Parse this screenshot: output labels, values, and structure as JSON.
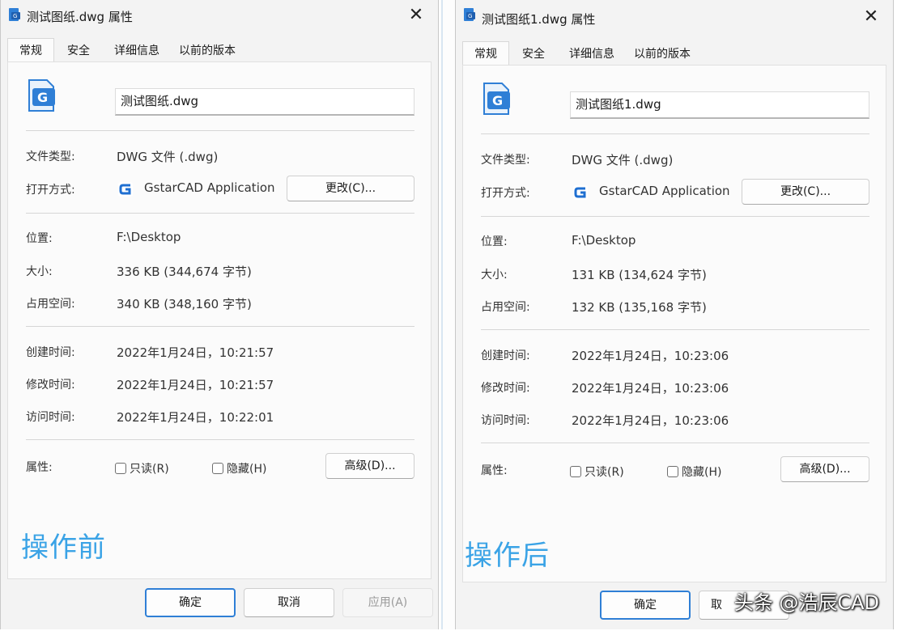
{
  "left": {
    "title": "测试图纸.dwg 属性",
    "tabs": [
      "常规",
      "安全",
      "详细信息",
      "以前的版本"
    ],
    "filename": "测试图纸.dwg",
    "labels": {
      "type": "文件类型:",
      "open_with": "打开方式:",
      "location": "位置:",
      "size": "大小:",
      "size_on_disk": "占用空间:",
      "created": "创建时间:",
      "modified": "修改时间:",
      "accessed": "访问时间:",
      "attributes": "属性:"
    },
    "values": {
      "type": "DWG 文件 (.dwg)",
      "open_with": "GstarCAD Application",
      "location": "F:\\Desktop",
      "size": "336 KB (344,674 字节)",
      "size_on_disk": "340 KB (348,160 字节)",
      "created": "2022年1月24日，10:21:57",
      "modified": "2022年1月24日，10:21:57",
      "accessed": "2022年1月24日，10:22:01"
    },
    "change_button": "更改(C)...",
    "readonly_label": "只读(R)",
    "hidden_label": "隐藏(H)",
    "advanced_button": "高级(D)...",
    "watermark": "操作前",
    "ok_button": "确定",
    "cancel_button": "取消",
    "apply_button": "应用(A)"
  },
  "right": {
    "title": "测试图纸1.dwg 属性",
    "tabs": [
      "常规",
      "安全",
      "详细信息",
      "以前的版本"
    ],
    "filename": "测试图纸1.dwg",
    "labels": {
      "type": "文件类型:",
      "open_with": "打开方式:",
      "location": "位置:",
      "size": "大小:",
      "size_on_disk": "占用空间:",
      "created": "创建时间:",
      "modified": "修改时间:",
      "accessed": "访问时间:",
      "attributes": "属性:"
    },
    "values": {
      "type": "DWG 文件 (.dwg)",
      "open_with": "GstarCAD Application",
      "location": "F:\\Desktop",
      "size": "131 KB (134,624 字节)",
      "size_on_disk": "132 KB (135,168 字节)",
      "created": "2022年1月24日，10:23:06",
      "modified": "2022年1月24日，10:23:06",
      "accessed": "2022年1月24日，10:23:06"
    },
    "change_button": "更改(C)...",
    "readonly_label": "只读(R)",
    "hidden_label": "隐藏(H)",
    "advanced_button": "高级(D)...",
    "watermark": "操作后",
    "ok_button": "确定",
    "cancel_button": "取"
  },
  "brand_watermark": "头条 @浩辰CAD",
  "colors": {
    "accent": "#2f7fd6",
    "watermark": "#3aa3e6",
    "dialog_bg": "#f3f3f3",
    "panel_bg": "#fbfbfb"
  },
  "icons": {
    "title": "dwg-file-icon",
    "close": "close-icon",
    "app": "gstarcad-icon"
  }
}
